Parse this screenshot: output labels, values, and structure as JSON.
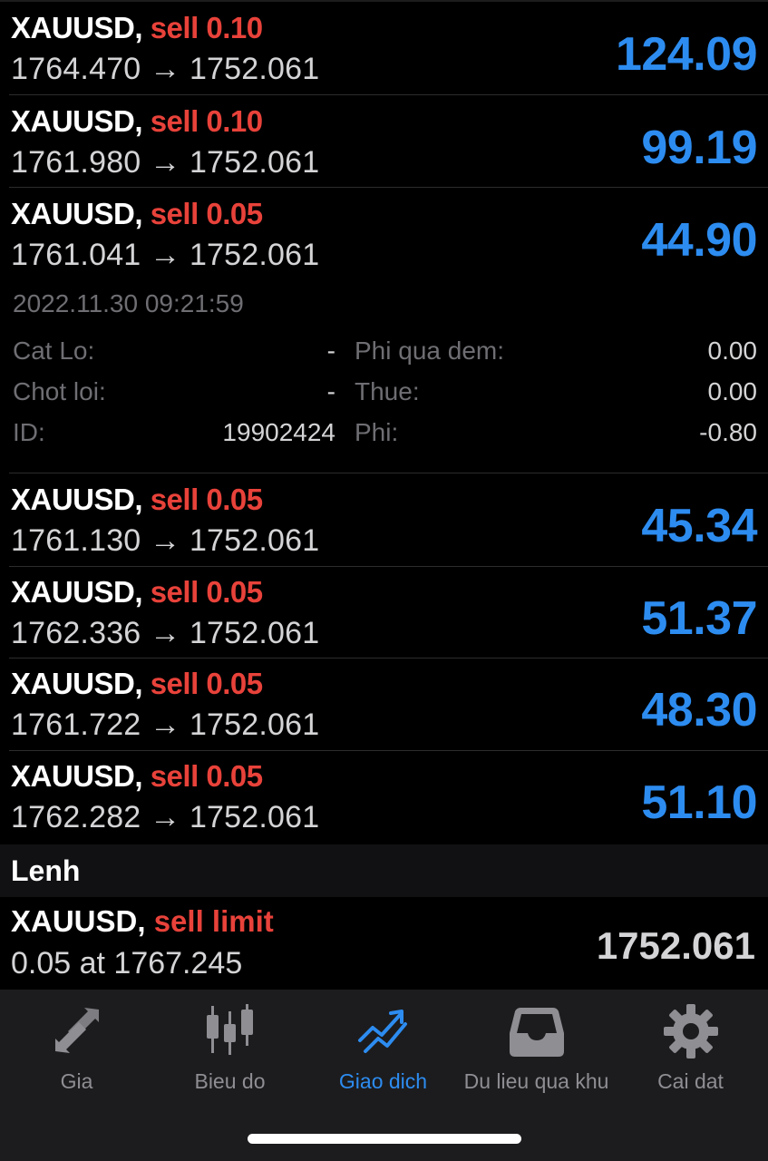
{
  "positions": [
    {
      "symbol": "XAUUSD,",
      "side": "sell 0.10",
      "open": "1764.470",
      "arrow": "→",
      "current": "1752.061",
      "profit": "124.09"
    },
    {
      "symbol": "XAUUSD,",
      "side": "sell 0.10",
      "open": "1761.980",
      "arrow": "→",
      "current": "1752.061",
      "profit": "99.19"
    },
    {
      "symbol": "XAUUSD,",
      "side": "sell 0.05",
      "open": "1761.041",
      "arrow": "→",
      "current": "1752.061",
      "profit": "44.90"
    },
    {
      "symbol": "XAUUSD,",
      "side": "sell 0.05",
      "open": "1761.130",
      "arrow": "→",
      "current": "1752.061",
      "profit": "45.34"
    },
    {
      "symbol": "XAUUSD,",
      "side": "sell 0.05",
      "open": "1762.336",
      "arrow": "→",
      "current": "1752.061",
      "profit": "51.37"
    },
    {
      "symbol": "XAUUSD,",
      "side": "sell 0.05",
      "open": "1761.722",
      "arrow": "→",
      "current": "1752.061",
      "profit": "48.30"
    },
    {
      "symbol": "XAUUSD,",
      "side": "sell 0.05",
      "open": "1762.282",
      "arrow": "→",
      "current": "1752.061",
      "profit": "51.10"
    }
  ],
  "details": {
    "datetime": "2022.11.30 09:21:59",
    "stop_loss_label": "Cat Lo:",
    "stop_loss_value": "-",
    "take_profit_label": "Chot loi:",
    "take_profit_value": "-",
    "id_label": "ID:",
    "id_value": "19902424",
    "swap_label": "Phi qua dem:",
    "swap_value": "0.00",
    "tax_label": "Thue:",
    "tax_value": "0.00",
    "fee_label": "Phi:",
    "fee_value": "-0.80"
  },
  "orders_section": {
    "title": "Lenh"
  },
  "order": {
    "symbol": "XAUUSD,",
    "side": "sell limit",
    "volume_line": "0.05 at 1767.245",
    "current": "1752.061"
  },
  "tabs": [
    {
      "label": "Gia",
      "icon": "arrows-icon",
      "active": false
    },
    {
      "label": "Bieu do",
      "icon": "candlestick-icon",
      "active": false
    },
    {
      "label": "Giao dich",
      "icon": "trade-icon",
      "active": true
    },
    {
      "label": "Du lieu qua khu",
      "icon": "history-inbox-icon",
      "active": false
    },
    {
      "label": "Cai dat",
      "icon": "gear-icon",
      "active": false
    }
  ],
  "colors": {
    "sell": "#e8423a",
    "profit": "#2d8cf0",
    "active_tab": "#2d8cf0",
    "inactive_tab": "#8e8e93"
  }
}
